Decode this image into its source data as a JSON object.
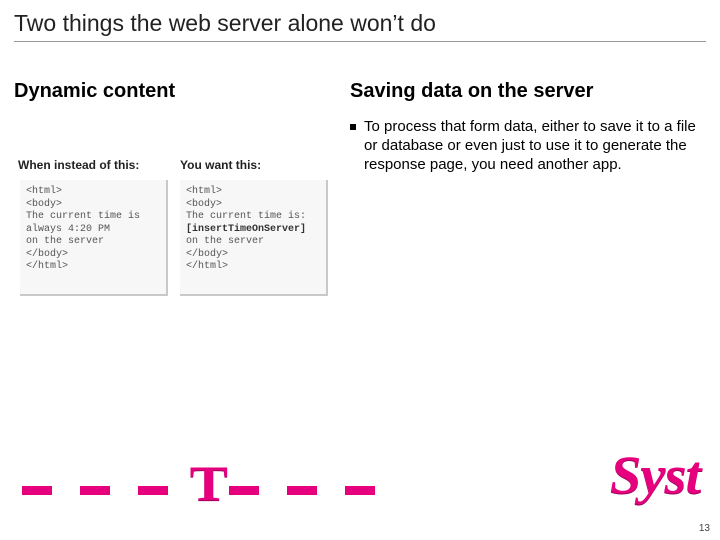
{
  "title": "Two things the web server alone won’t do",
  "left": {
    "heading": "Dynamic content",
    "label1": "When instead of this:",
    "label2": "You want this:",
    "code1": "<html>\n<body>\nThe current time is\nalways 4:20 PM\non the server\n</body>\n</html>",
    "code2_pre": "<html>\n<body>\nThe current time is:\n",
    "code2_bold": "[insertTimeOnServer]",
    "code2_post": "\non the server\n</body>\n</html>"
  },
  "right": {
    "heading": "Saving data on the server",
    "bullet": "To process that form data, either to save it to a file or database or even just to use it to generate the response page, you need another app."
  },
  "logo": {
    "word": "Syst"
  },
  "page": "13"
}
